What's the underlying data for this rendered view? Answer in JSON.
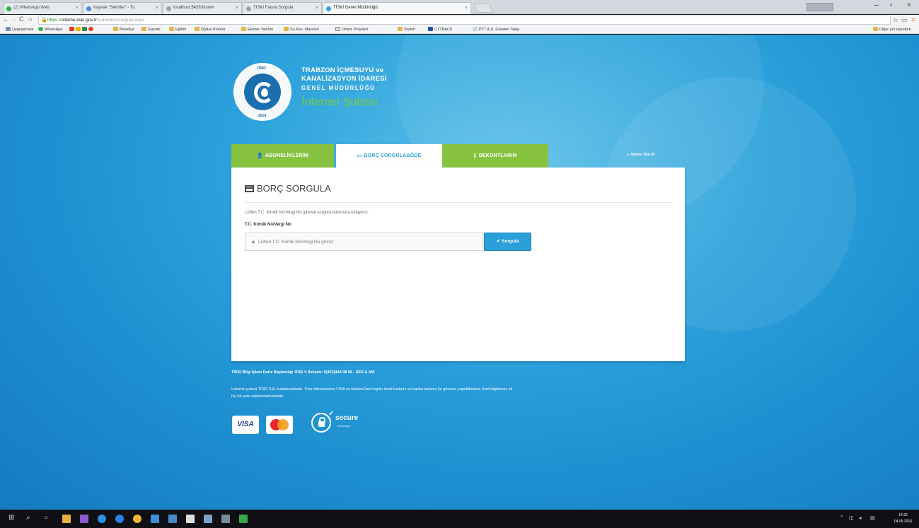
{
  "browser": {
    "tabs": [
      {
        "label": "(2) WhatsApp Web",
        "active": false
      },
      {
        "label": "Kaynak \"Sehirler\" - Tu",
        "active": false
      },
      {
        "label": "localhost:54393/Islem",
        "active": false
      },
      {
        "label": "TISKI Fatura Sorgula",
        "active": false
      },
      {
        "label": "TİSKİ Genel Müdürlüğü",
        "active": true
      }
    ],
    "url_domain": "odeme.tiski.gov.tr",
    "url_path": "/sube/borcsorgula.aspx",
    "url_prefix": "https://",
    "bookmarks": [
      "Uygulamalar",
      "WhatsApp",
      "Belediye",
      "Gazete",
      "Eğitim",
      "Diyital Ürünler",
      "Ekmek Yazılım",
      "Su Kes. İdareleri",
      "Ortam Projeleri",
      "Switch",
      "CTTBACK",
      "PTT A.Ş. Gönderi Takip"
    ],
    "other_bookmarks": "Diğer yer işaretleri"
  },
  "header": {
    "line1": "TRABZON İÇMESUYU ve",
    "line2": "KANALİZASYON İDARESİ",
    "line3": "GENEL MÜDÜRLÜĞÜ",
    "line4": "İnternet Şubesi",
    "seal_text": "TİSKİ",
    "seal_year": "2014"
  },
  "nav": {
    "tabs": [
      {
        "label": "ABONELİKLERİM",
        "icon": "user-icon"
      },
      {
        "label": "BORÇ SORGULA&ÖDE",
        "icon": "credit-card-icon"
      },
      {
        "label": "DEKONTLARIM",
        "icon": "document-icon"
      }
    ],
    "home_link": "Hemen Üye Ol"
  },
  "panel": {
    "title": "BORÇ SORGULA",
    "hint": "Lütfen T.C. Kimlik No/Vergi No girerek sorgula butonuna tıklayınız.",
    "label": "T.C. Kimlik No/Vergi No",
    "input_placeholder": "Lütfen T.C. Kimlik No/Vergi No giriniz",
    "input_value": "",
    "button_label": "Sorgula"
  },
  "footer": {
    "copyright": "TİSKİ Bilgi İşlem Daire Başkanlığı 2016 © İletişim: 0(462)444 08 09 - SES & AM",
    "note": "İnternet şubesi TİSKİ SSL kullanmaktadır. Tüm ödemeleriniz VISA ve MasterCard logolu kredi kartınız ve banka kartınız ile güvenle yapabilirsiniz. Kart bilgileriniz sit hiç bir yere saklanmamaktadır.",
    "visa_label": "VISA",
    "secure_title": "secure",
    "secure_sub": "GlobalSign"
  },
  "taskbar": {
    "time": "14:22",
    "date": "04.05.2016"
  },
  "colors": {
    "background_blue": "#2ea3dc",
    "nav_green": "#87c241",
    "button_blue": "#2a9fd8",
    "title_green": "#7ccb3a"
  }
}
